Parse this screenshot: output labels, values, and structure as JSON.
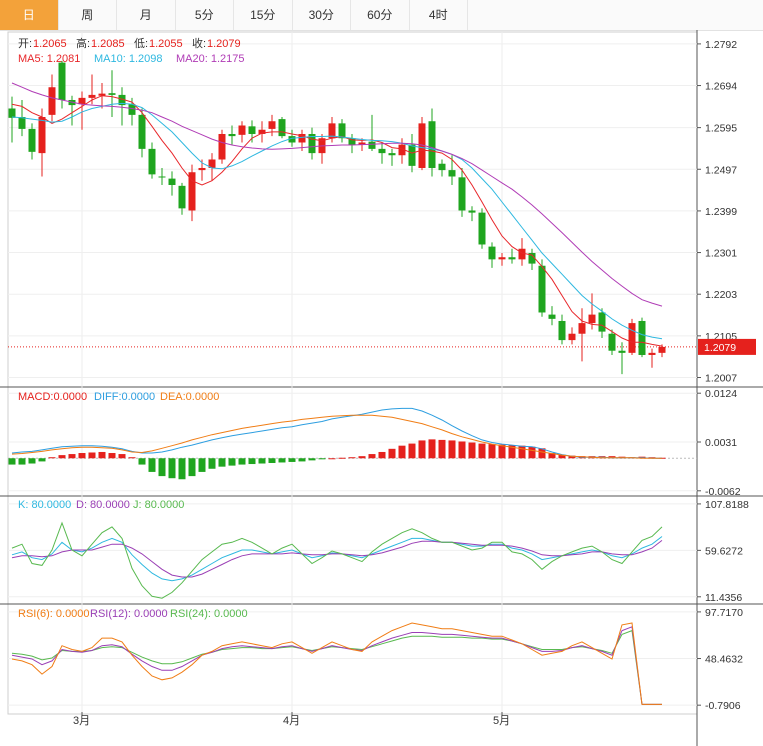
{
  "tabs": [
    "日",
    "周",
    "月",
    "5分",
    "15分",
    "30分",
    "60分",
    "4时"
  ],
  "active_tab": 0,
  "colors": {
    "up": "#e5211d",
    "down": "#1fa51f",
    "ma5": "#e8262a",
    "ma10": "#2eb8e0",
    "ma20": "#b03cb6",
    "diff": "#2d9ee0",
    "dea": "#f07d15",
    "k": "#2eb8e0",
    "d": "#9a3fb5",
    "j": "#58b94f",
    "rsi6": "#f07d15",
    "rsi12": "#9a3fb5",
    "rsi24": "#58b94f",
    "last_price_bg": "#e5211d"
  },
  "ohlc_legend": {
    "open_label": "开:",
    "open": "1.2065",
    "high_label": "高:",
    "high": "1.2085",
    "low_label": "低:",
    "low": "1.2055",
    "close_label": "收:",
    "close": "1.2079"
  },
  "ma_legend": {
    "ma5": "MA5: 1.2081",
    "ma10": "MA10: 1.2098",
    "ma20": "MA20: 1.2175"
  },
  "macd_legend": {
    "macd": "MACD:0.0000",
    "diff": "DIFF:0.0000",
    "dea": "DEA:0.0000"
  },
  "kdj_legend": {
    "k": "K: 80.0000",
    "d": "D: 80.0000",
    "j": "J: 80.0000"
  },
  "rsi_legend": {
    "rsi6": "RSI(6): 0.0000",
    "rsi12": "RSI(12): 0.0000",
    "rsi24": "RSI(24): 0.0000"
  },
  "chart_data": {
    "type": "candlestick",
    "last_price": "1.2079",
    "price_axis": {
      "ticks": [
        "1.2792",
        "1.2694",
        "1.2595",
        "1.2497",
        "1.2399",
        "1.2301",
        "1.2203",
        "1.2105",
        "1.2007"
      ],
      "ylim": [
        1.1987,
        1.282
      ]
    },
    "macd_axis": {
      "ticks": [
        "0.0124",
        "0.0031",
        "-0.0062"
      ],
      "ylim": [
        -0.007,
        0.0132
      ]
    },
    "kdj_axis": {
      "ticks": [
        "107.8188",
        "59.6272",
        "11.4356"
      ],
      "ylim": [
        5,
        115
      ]
    },
    "rsi_axis": {
      "ticks": [
        "97.7170",
        "48.4632",
        "-0.7906"
      ],
      "ylim": [
        -8,
        105
      ]
    },
    "x_labels": [
      {
        "label": "3月",
        "index": 2
      },
      {
        "label": "4月",
        "index": 23
      },
      {
        "label": "5月",
        "index": 44
      }
    ],
    "candles": [
      {
        "o": 1.264,
        "h": 1.2668,
        "l": 1.256,
        "c": 1.2618
      },
      {
        "o": 1.262,
        "h": 1.266,
        "l": 1.2575,
        "c": 1.2592
      },
      {
        "o": 1.2592,
        "h": 1.2605,
        "l": 1.252,
        "c": 1.2538
      },
      {
        "o": 1.2535,
        "h": 1.264,
        "l": 1.248,
        "c": 1.262
      },
      {
        "o": 1.2625,
        "h": 1.272,
        "l": 1.261,
        "c": 1.269
      },
      {
        "o": 1.2748,
        "h": 1.2752,
        "l": 1.264,
        "c": 1.266
      },
      {
        "o": 1.266,
        "h": 1.267,
        "l": 1.26,
        "c": 1.2648
      },
      {
        "o": 1.265,
        "h": 1.268,
        "l": 1.259,
        "c": 1.2665
      },
      {
        "o": 1.2665,
        "h": 1.272,
        "l": 1.265,
        "c": 1.2672
      },
      {
        "o": 1.267,
        "h": 1.27,
        "l": 1.264,
        "c": 1.2675
      },
      {
        "o": 1.2676,
        "h": 1.273,
        "l": 1.262,
        "c": 1.2672
      },
      {
        "o": 1.2672,
        "h": 1.269,
        "l": 1.26,
        "c": 1.2648
      },
      {
        "o": 1.265,
        "h": 1.2665,
        "l": 1.26,
        "c": 1.2625
      },
      {
        "o": 1.2625,
        "h": 1.264,
        "l": 1.2525,
        "c": 1.2545
      },
      {
        "o": 1.2545,
        "h": 1.256,
        "l": 1.2475,
        "c": 1.2485
      },
      {
        "o": 1.248,
        "h": 1.25,
        "l": 1.246,
        "c": 1.2478
      },
      {
        "o": 1.2475,
        "h": 1.2492,
        "l": 1.2435,
        "c": 1.246
      },
      {
        "o": 1.2458,
        "h": 1.2465,
        "l": 1.239,
        "c": 1.2405
      },
      {
        "o": 1.24,
        "h": 1.2508,
        "l": 1.2375,
        "c": 1.249
      },
      {
        "o": 1.2495,
        "h": 1.252,
        "l": 1.247,
        "c": 1.25
      },
      {
        "o": 1.25,
        "h": 1.2535,
        "l": 1.247,
        "c": 1.252
      },
      {
        "o": 1.252,
        "h": 1.259,
        "l": 1.251,
        "c": 1.258
      },
      {
        "o": 1.258,
        "h": 1.26,
        "l": 1.2555,
        "c": 1.2575
      },
      {
        "o": 1.2578,
        "h": 1.261,
        "l": 1.256,
        "c": 1.26
      },
      {
        "o": 1.2598,
        "h": 1.2612,
        "l": 1.256,
        "c": 1.258
      },
      {
        "o": 1.258,
        "h": 1.261,
        "l": 1.256,
        "c": 1.259
      },
      {
        "o": 1.2592,
        "h": 1.2625,
        "l": 1.2575,
        "c": 1.261
      },
      {
        "o": 1.2615,
        "h": 1.262,
        "l": 1.257,
        "c": 1.2575
      },
      {
        "o": 1.2575,
        "h": 1.259,
        "l": 1.255,
        "c": 1.256
      },
      {
        "o": 1.256,
        "h": 1.259,
        "l": 1.254,
        "c": 1.258
      },
      {
        "o": 1.258,
        "h": 1.2595,
        "l": 1.252,
        "c": 1.2535
      },
      {
        "o": 1.2535,
        "h": 1.258,
        "l": 1.251,
        "c": 1.257
      },
      {
        "o": 1.257,
        "h": 1.262,
        "l": 1.256,
        "c": 1.2605
      },
      {
        "o": 1.2605,
        "h": 1.2615,
        "l": 1.256,
        "c": 1.257
      },
      {
        "o": 1.257,
        "h": 1.258,
        "l": 1.2535,
        "c": 1.2555
      },
      {
        "o": 1.2555,
        "h": 1.257,
        "l": 1.254,
        "c": 1.256
      },
      {
        "o": 1.2562,
        "h": 1.2625,
        "l": 1.254,
        "c": 1.2545
      },
      {
        "o": 1.2545,
        "h": 1.256,
        "l": 1.251,
        "c": 1.2535
      },
      {
        "o": 1.2535,
        "h": 1.2545,
        "l": 1.2505,
        "c": 1.253
      },
      {
        "o": 1.253,
        "h": 1.257,
        "l": 1.251,
        "c": 1.2555
      },
      {
        "o": 1.2555,
        "h": 1.258,
        "l": 1.249,
        "c": 1.2505
      },
      {
        "o": 1.25,
        "h": 1.262,
        "l": 1.2495,
        "c": 1.2605
      },
      {
        "o": 1.261,
        "h": 1.264,
        "l": 1.248,
        "c": 1.25
      },
      {
        "o": 1.251,
        "h": 1.252,
        "l": 1.248,
        "c": 1.2495
      },
      {
        "o": 1.2495,
        "h": 1.253,
        "l": 1.246,
        "c": 1.248
      },
      {
        "o": 1.2478,
        "h": 1.25,
        "l": 1.2385,
        "c": 1.24
      },
      {
        "o": 1.24,
        "h": 1.241,
        "l": 1.2375,
        "c": 1.2395
      },
      {
        "o": 1.2395,
        "h": 1.2405,
        "l": 1.231,
        "c": 1.232
      },
      {
        "o": 1.2315,
        "h": 1.2325,
        "l": 1.2265,
        "c": 1.2285
      },
      {
        "o": 1.2285,
        "h": 1.23,
        "l": 1.227,
        "c": 1.229
      },
      {
        "o": 1.229,
        "h": 1.231,
        "l": 1.2275,
        "c": 1.2285
      },
      {
        "o": 1.2285,
        "h": 1.2335,
        "l": 1.227,
        "c": 1.231
      },
      {
        "o": 1.23,
        "h": 1.231,
        "l": 1.226,
        "c": 1.2275
      },
      {
        "o": 1.227,
        "h": 1.2285,
        "l": 1.215,
        "c": 1.216
      },
      {
        "o": 1.2155,
        "h": 1.2175,
        "l": 1.213,
        "c": 1.2145
      },
      {
        "o": 1.214,
        "h": 1.2155,
        "l": 1.2085,
        "c": 1.2095
      },
      {
        "o": 1.2095,
        "h": 1.2125,
        "l": 1.2085,
        "c": 1.211
      },
      {
        "o": 1.211,
        "h": 1.217,
        "l": 1.2045,
        "c": 1.2135
      },
      {
        "o": 1.2135,
        "h": 1.2205,
        "l": 1.212,
        "c": 1.2155
      },
      {
        "o": 1.216,
        "h": 1.217,
        "l": 1.21,
        "c": 1.2115
      },
      {
        "o": 1.211,
        "h": 1.212,
        "l": 1.206,
        "c": 1.207
      },
      {
        "o": 1.207,
        "h": 1.209,
        "l": 1.2015,
        "c": 1.2065
      },
      {
        "o": 1.2065,
        "h": 1.2145,
        "l": 1.206,
        "c": 1.2135
      },
      {
        "o": 1.214,
        "h": 1.2148,
        "l": 1.2055,
        "c": 1.206
      },
      {
        "o": 1.206,
        "h": 1.2075,
        "l": 1.203,
        "c": 1.2065
      },
      {
        "o": 1.2065,
        "h": 1.2085,
        "l": 1.2055,
        "c": 1.2079
      }
    ],
    "ma5": [
      1.265,
      1.2645,
      1.263,
      1.262,
      1.2605,
      1.2615,
      1.263,
      1.2645,
      1.266,
      1.267,
      1.2668,
      1.2662,
      1.2655,
      1.263,
      1.2598,
      1.2565,
      1.2535,
      1.25,
      1.247,
      1.246,
      1.247,
      1.249,
      1.2515,
      1.2545,
      1.257,
      1.2582,
      1.2585,
      1.2585,
      1.258,
      1.2576,
      1.2568,
      1.2564,
      1.257,
      1.2574,
      1.2566,
      1.2565,
      1.2566,
      1.256,
      1.2548,
      1.2545,
      1.2535,
      1.2542,
      1.254,
      1.2535,
      1.252,
      1.2495,
      1.246,
      1.242,
      1.2378,
      1.234,
      1.2315,
      1.23,
      1.2295,
      1.2268,
      1.2238,
      1.22,
      1.2162,
      1.214,
      1.2132,
      1.213,
      1.2115,
      1.21,
      1.209,
      1.209,
      1.2085,
      1.2081
    ],
    "ma10": [
      1.262,
      1.2618,
      1.2615,
      1.2612,
      1.2608,
      1.261,
      1.262,
      1.2632,
      1.264,
      1.2645,
      1.265,
      1.2652,
      1.265,
      1.2642,
      1.2625,
      1.2605,
      1.2585,
      1.256,
      1.2535,
      1.2512,
      1.25,
      1.2498,
      1.2505,
      1.2515,
      1.2528,
      1.254,
      1.2552,
      1.2562,
      1.257,
      1.2572,
      1.2574,
      1.2574,
      1.2575,
      1.2573,
      1.257,
      1.2567,
      1.2565,
      1.2564,
      1.2562,
      1.2558,
      1.2552,
      1.2548,
      1.2545,
      1.254,
      1.2532,
      1.252,
      1.25,
      1.2475,
      1.245,
      1.242,
      1.239,
      1.236,
      1.233,
      1.23,
      1.2275,
      1.225,
      1.2225,
      1.22,
      1.218,
      1.2163,
      1.2145,
      1.213,
      1.2118,
      1.2108,
      1.2102,
      1.2098
    ],
    "ma20": [
      1.27,
      1.269,
      1.268,
      1.2672,
      1.2665,
      1.266,
      1.2655,
      1.265,
      1.2648,
      1.2646,
      1.2645,
      1.2643,
      1.264,
      1.2636,
      1.263,
      1.262,
      1.261,
      1.2598,
      1.2588,
      1.2578,
      1.2568,
      1.256,
      1.2554,
      1.255,
      1.2547,
      1.2545,
      1.2544,
      1.2545,
      1.2546,
      1.2548,
      1.255,
      1.2552,
      1.2553,
      1.2554,
      1.2554,
      1.2555,
      1.2556,
      1.2557,
      1.2558,
      1.2558,
      1.2557,
      1.2554,
      1.2548,
      1.254,
      1.2532,
      1.2522,
      1.251,
      1.2495,
      1.248,
      1.2465,
      1.245,
      1.2432,
      1.2413,
      1.2392,
      1.237,
      1.2348,
      1.2325,
      1.2302,
      1.228,
      1.226,
      1.224,
      1.2222,
      1.2205,
      1.219,
      1.2182,
      1.2175
    ],
    "macd_hist": [
      -0.0012,
      -0.0012,
      -0.001,
      -0.0006,
      0.0002,
      0.0006,
      0.0008,
      0.001,
      0.0011,
      0.0012,
      0.001,
      0.0008,
      0.0002,
      -0.0012,
      -0.0026,
      -0.0034,
      -0.0038,
      -0.004,
      -0.0034,
      -0.0026,
      -0.002,
      -0.0016,
      -0.0014,
      -0.0012,
      -0.0011,
      -0.001,
      -0.0009,
      -0.0008,
      -0.0007,
      -0.0006,
      -0.0004,
      -0.0002,
      0.0,
      0.0001,
      0.0002,
      0.0004,
      0.0008,
      0.0012,
      0.0018,
      0.0024,
      0.0028,
      0.0034,
      0.0036,
      0.0035,
      0.0034,
      0.0032,
      0.003,
      0.0028,
      0.0027,
      0.0026,
      0.0025,
      0.0024,
      0.0022,
      0.0019,
      0.001,
      0.0007,
      0.0005,
      0.0004,
      0.0004,
      0.0004,
      0.0004,
      0.0003,
      0.0002,
      0.0003,
      0.0002,
      0.0001
    ],
    "macd_diff": [
      0.001,
      0.0012,
      0.0013,
      0.0016,
      0.0019,
      0.0022,
      0.0023,
      0.0024,
      0.0024,
      0.0023,
      0.0021,
      0.0018,
      0.0013,
      0.001,
      0.001,
      0.0012,
      0.0016,
      0.0021,
      0.0025,
      0.003,
      0.0035,
      0.0039,
      0.0043,
      0.0046,
      0.0049,
      0.0052,
      0.0055,
      0.0058,
      0.006,
      0.0064,
      0.0067,
      0.007,
      0.0075,
      0.0078,
      0.0081,
      0.0084,
      0.0088,
      0.0092,
      0.0094,
      0.0095,
      0.0095,
      0.009,
      0.0082,
      0.0073,
      0.0062,
      0.0052,
      0.0043,
      0.0035,
      0.003,
      0.0027,
      0.0025,
      0.0023,
      0.0022,
      0.0018,
      0.0012,
      0.0007,
      0.0004,
      0.0002,
      0.0002,
      0.0002,
      0.0001,
      0.0001,
      0.0001,
      0.0001,
      0.0,
      0.0
    ],
    "macd_dea": [
      0.0008,
      0.0009,
      0.0011,
      0.0013,
      0.0016,
      0.0018,
      0.002,
      0.0021,
      0.0021,
      0.002,
      0.0019,
      0.0016,
      0.0012,
      0.0011,
      0.0014,
      0.0019,
      0.0024,
      0.0029,
      0.0035,
      0.004,
      0.0045,
      0.0049,
      0.0053,
      0.0057,
      0.006,
      0.0063,
      0.0066,
      0.0069,
      0.0071,
      0.0074,
      0.0076,
      0.0078,
      0.008,
      0.0081,
      0.0082,
      0.0082,
      0.0082,
      0.008,
      0.0078,
      0.0074,
      0.007,
      0.0066,
      0.006,
      0.0054,
      0.0047,
      0.0041,
      0.0036,
      0.0031,
      0.0027,
      0.0024,
      0.0021,
      0.0018,
      0.0015,
      0.0012,
      0.0009,
      0.0006,
      0.0004,
      0.0003,
      0.0002,
      0.0001,
      0.0001,
      0.0001,
      0.0001,
      0.0,
      0.0,
      0.0
    ],
    "kdj_k": [
      55,
      58,
      52,
      50,
      56,
      68,
      60,
      58,
      62,
      68,
      72,
      68,
      55,
      45,
      36,
      30,
      28,
      30,
      34,
      40,
      46,
      52,
      56,
      60,
      60,
      58,
      56,
      58,
      60,
      56,
      52,
      54,
      57,
      56,
      54,
      52,
      56,
      60,
      64,
      68,
      72,
      72,
      70,
      68,
      68,
      66,
      64,
      64,
      66,
      66,
      62,
      60,
      56,
      50,
      52,
      54,
      56,
      58,
      60,
      58,
      54,
      52,
      56,
      62,
      66,
      74
    ],
    "kdj_d": [
      52,
      54,
      54,
      53,
      54,
      58,
      60,
      60,
      60,
      63,
      66,
      66,
      62,
      56,
      48,
      40,
      34,
      32,
      32,
      35,
      40,
      45,
      50,
      54,
      56,
      56,
      56,
      56,
      57,
      56,
      55,
      55,
      56,
      56,
      55,
      54,
      55,
      57,
      60,
      63,
      67,
      69,
      69,
      68,
      68,
      67,
      66,
      65,
      65,
      65,
      64,
      62,
      59,
      55,
      54,
      54,
      55,
      56,
      58,
      58,
      56,
      55,
      55,
      58,
      62,
      70
    ],
    "kdj_j": [
      62,
      66,
      46,
      44,
      60,
      88,
      60,
      54,
      66,
      78,
      84,
      72,
      41,
      23,
      12,
      10,
      16,
      26,
      38,
      50,
      58,
      66,
      68,
      72,
      68,
      62,
      56,
      62,
      66,
      56,
      46,
      52,
      59,
      56,
      52,
      48,
      58,
      66,
      72,
      78,
      82,
      78,
      72,
      68,
      68,
      64,
      60,
      62,
      68,
      68,
      58,
      56,
      50,
      40,
      48,
      54,
      58,
      62,
      64,
      58,
      50,
      46,
      58,
      70,
      74,
      84
    ],
    "rsi6": [
      48,
      46,
      42,
      32,
      40,
      62,
      58,
      56,
      60,
      70,
      70,
      66,
      52,
      40,
      30,
      26,
      28,
      34,
      42,
      52,
      56,
      62,
      64,
      66,
      64,
      62,
      60,
      64,
      66,
      60,
      54,
      60,
      66,
      62,
      58,
      56,
      66,
      72,
      78,
      82,
      86,
      84,
      82,
      80,
      80,
      78,
      76,
      74,
      72,
      72,
      68,
      64,
      58,
      52,
      54,
      56,
      62,
      66,
      60,
      54,
      48,
      84,
      86,
      0,
      0,
      0
    ],
    "rsi12": [
      52,
      50,
      48,
      42,
      46,
      58,
      56,
      55,
      57,
      62,
      63,
      61,
      53,
      46,
      40,
      36,
      36,
      40,
      46,
      52,
      55,
      59,
      61,
      62,
      61,
      60,
      59,
      61,
      62,
      59,
      56,
      59,
      62,
      60,
      58,
      57,
      62,
      66,
      70,
      73,
      76,
      76,
      75,
      74,
      74,
      73,
      72,
      71,
      70,
      70,
      67,
      64,
      60,
      56,
      56,
      57,
      60,
      62,
      59,
      56,
      52,
      78,
      82,
      0,
      0,
      0
    ],
    "rsi24": [
      54,
      53,
      51,
      47,
      49,
      57,
      56,
      56,
      57,
      60,
      61,
      60,
      55,
      50,
      46,
      43,
      43,
      45,
      49,
      53,
      55,
      58,
      59,
      60,
      60,
      59,
      59,
      60,
      61,
      59,
      57,
      59,
      61,
      60,
      59,
      58,
      61,
      64,
      67,
      70,
      72,
      72,
      72,
      71,
      71,
      71,
      70,
      70,
      69,
      69,
      67,
      64,
      61,
      58,
      58,
      58,
      60,
      61,
      59,
      57,
      54,
      74,
      78,
      0,
      0,
      0
    ]
  }
}
